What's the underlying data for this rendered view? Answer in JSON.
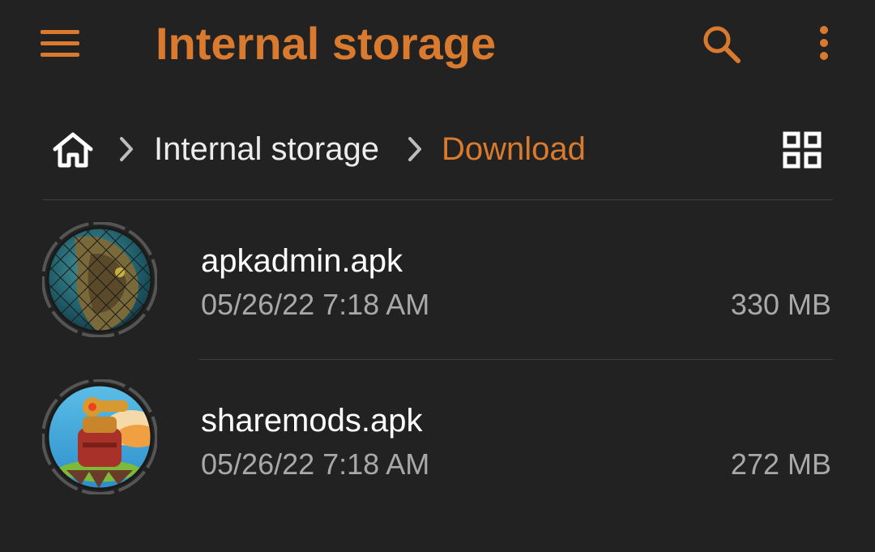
{
  "appbar": {
    "title": "Internal storage",
    "menu_icon": "hamburger-menu-icon",
    "search_icon": "search-icon",
    "more_icon": "more-vert-icon",
    "accent_color": "#D97A2E"
  },
  "breadcrumb": {
    "home_icon": "home-icon",
    "separator_icon": "chevron-right-icon",
    "items": [
      {
        "label": "Internal storage"
      },
      {
        "label": "Download"
      }
    ],
    "view_toggle_icon": "grid-view-icon"
  },
  "files": [
    {
      "name": "apkadmin.apk",
      "date": "05/26/22 7:18 AM",
      "size": "330 MB",
      "thumbnail_icon": "apk-app-icon"
    },
    {
      "name": "sharemods.apk",
      "date": "05/26/22 7:18 AM",
      "size": "272 MB",
      "thumbnail_icon": "apk-app-icon"
    }
  ],
  "colors": {
    "background": "#222222",
    "accent": "#D97A2E",
    "primary_text": "#FFFFFF",
    "secondary_text": "#A9A9A9",
    "divider": "#3E3E3E"
  }
}
